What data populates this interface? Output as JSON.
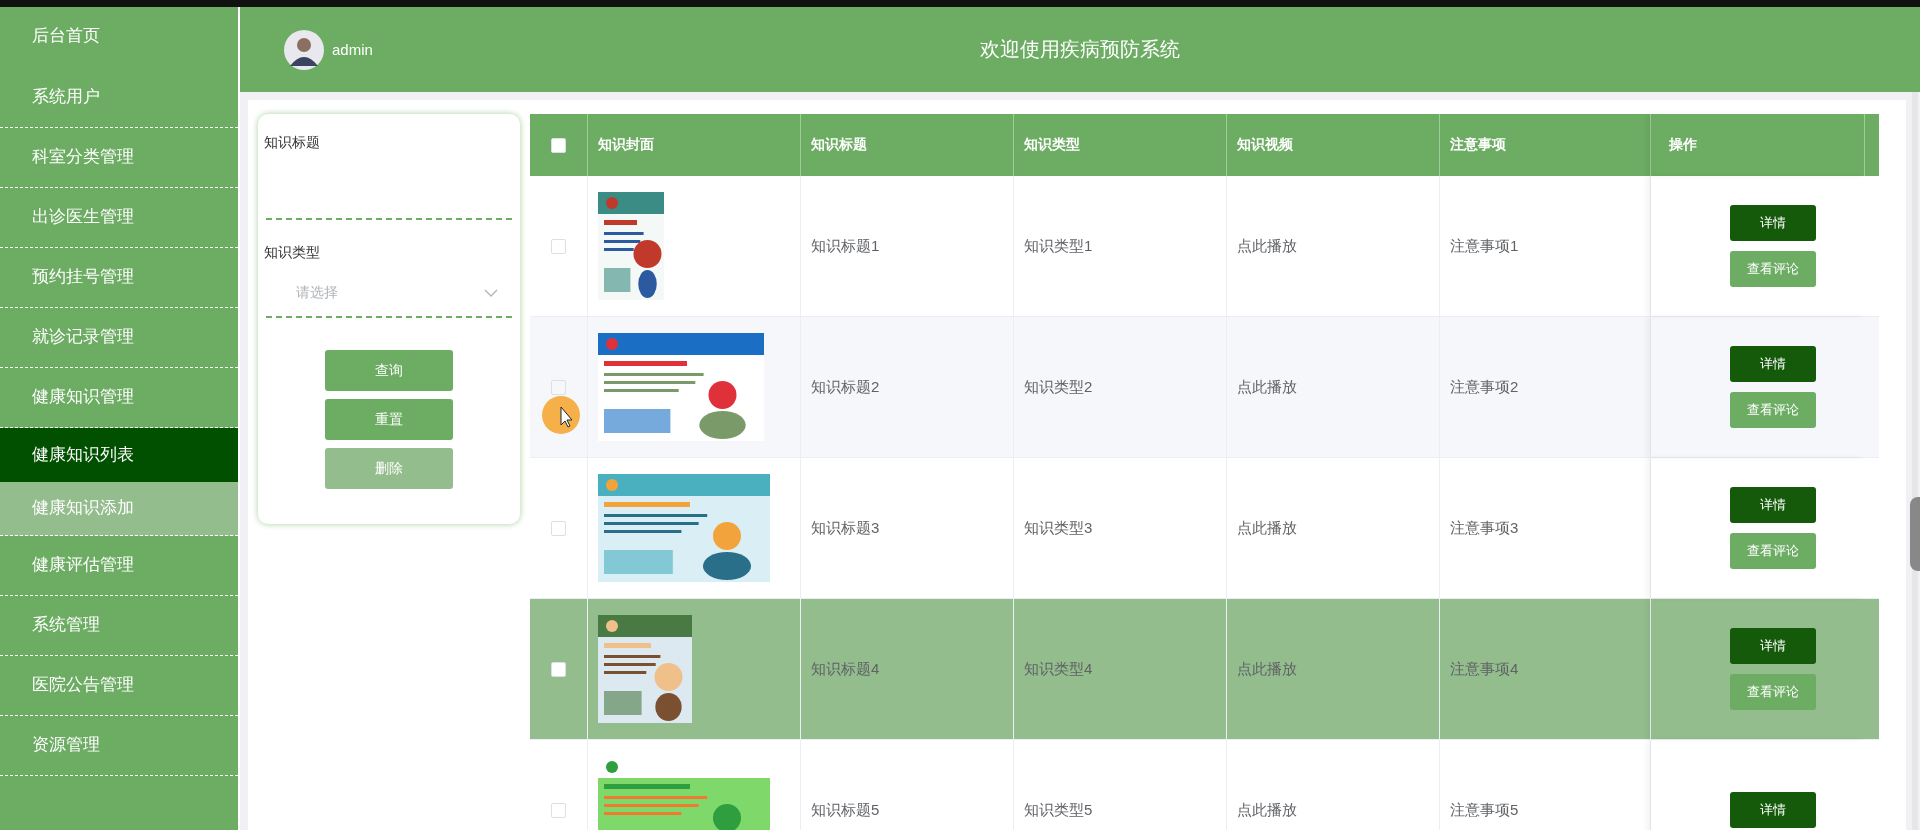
{
  "sidebar": {
    "items": [
      {
        "label": "后台首页",
        "selected": false,
        "hovered": false
      },
      {
        "label": "系统用户",
        "selected": false,
        "hovered": false
      },
      {
        "label": "科室分类管理",
        "selected": false,
        "hovered": false
      },
      {
        "label": "出诊医生管理",
        "selected": false,
        "hovered": false
      },
      {
        "label": "预约挂号管理",
        "selected": false,
        "hovered": false
      },
      {
        "label": "就诊记录管理",
        "selected": false,
        "hovered": false
      },
      {
        "label": "健康知识管理",
        "selected": false,
        "hovered": false
      },
      {
        "label": "健康知识列表",
        "selected": true,
        "hovered": false
      },
      {
        "label": "健康知识添加",
        "selected": false,
        "hovered": true
      },
      {
        "label": "健康评估管理",
        "selected": false,
        "hovered": false
      },
      {
        "label": "系统管理",
        "selected": false,
        "hovered": false
      },
      {
        "label": "医院公告管理",
        "selected": false,
        "hovered": false
      },
      {
        "label": "资源管理",
        "selected": false,
        "hovered": false
      }
    ]
  },
  "header": {
    "user": "admin",
    "title": "欢迎使用疾病预防系统"
  },
  "search": {
    "fields": [
      {
        "kind": "text",
        "label": "知识标题"
      },
      {
        "kind": "select",
        "label": "知识类型",
        "placeholder": "请选择"
      }
    ],
    "buttons": [
      {
        "label": "查询",
        "disabled": false
      },
      {
        "label": "重置",
        "disabled": false
      },
      {
        "label": "删除",
        "disabled": true
      }
    ]
  },
  "table": {
    "all_checked": false,
    "columns": [
      "知识封面",
      "知识标题",
      "知识类型",
      "知识视频",
      "注意事项",
      "操作"
    ],
    "rows": [
      {
        "checked": false,
        "hovered": false,
        "cover": {
          "kind": "picture"
        },
        "title": "知识标题1",
        "type": "知识类型1",
        "video": "点此播放",
        "notes": "注意事项1",
        "actions": [
          "详情",
          "查看评论"
        ]
      },
      {
        "checked": false,
        "hovered": false,
        "cover": {
          "kind": "picture"
        },
        "title": "知识标题2",
        "type": "知识类型2",
        "video": "点此播放",
        "notes": "注意事项2",
        "actions": [
          "详情",
          "查看评论"
        ]
      },
      {
        "checked": false,
        "hovered": false,
        "cover": {
          "kind": "picture"
        },
        "title": "知识标题3",
        "type": "知识类型3",
        "video": "点此播放",
        "notes": "注意事项3",
        "actions": [
          "详情",
          "查看评论"
        ]
      },
      {
        "checked": false,
        "hovered": true,
        "cover": {
          "kind": "picture"
        },
        "title": "知识标题4",
        "type": "知识类型4",
        "video": "点此播放",
        "notes": "注意事项4",
        "actions": [
          "详情",
          "查看评论"
        ]
      },
      {
        "checked": false,
        "hovered": false,
        "cover": {
          "kind": "picture"
        },
        "title": "知识标题5",
        "type": "知识类型5",
        "video": "点此播放",
        "notes": "注意事项5",
        "actions": [
          "详情"
        ]
      }
    ]
  }
}
